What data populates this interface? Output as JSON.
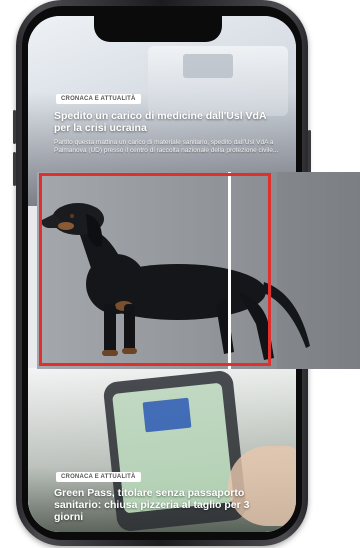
{
  "top_article": {
    "category": "CRONACA E ATTUALITÀ",
    "title": "Spedito un carico di medicine dall'Usl VdA per la crisi ucraina",
    "summary": "Partito questa mattina un carico di materiale sanitario, spedito dall'Usl VdA a Palmanova (UD) presso il centro di raccolta nazionale della protezione civile..."
  },
  "bottom_article": {
    "category": "CRONACA E ATTUALITÀ",
    "title": "Green Pass, titolare senza passaporto sanitario: chiusa pizzeria al taglio per 3 giorni"
  },
  "colors": {
    "selection_frame": "#e0302e",
    "divider": "#ffffff",
    "phone_body": "#1c1c1f"
  },
  "icons": {
    "notch": "phone-notch",
    "dog": "dachshund-image",
    "eu_flag": "eu-flag-icon"
  }
}
